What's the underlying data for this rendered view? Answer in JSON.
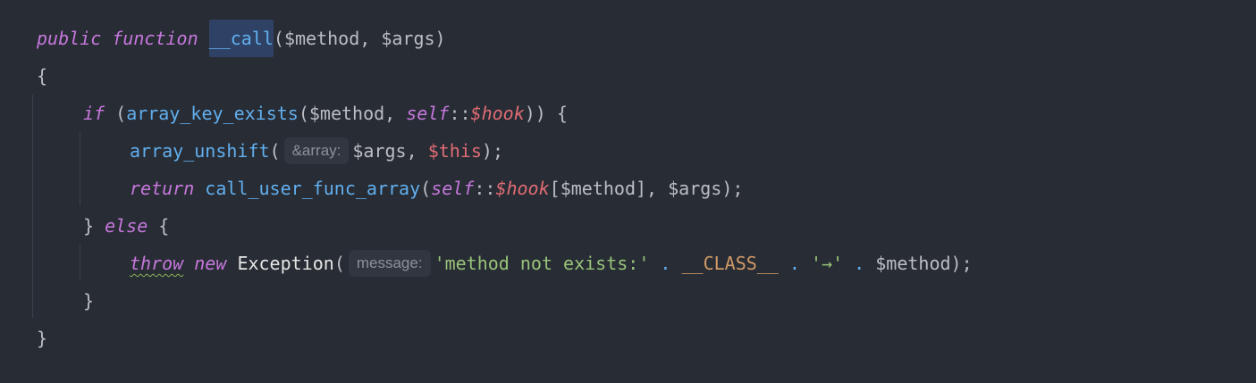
{
  "code": {
    "line1": {
      "public": "public",
      "function": "function",
      "name": "__call",
      "params": "($method, $args)"
    },
    "line2": {
      "brace": "{"
    },
    "line3": {
      "if": "if",
      "open": " (",
      "fn": "array_key_exists",
      "args_open": "($method, ",
      "self": "self",
      "dcolon": "::",
      "hook": "$hook",
      "close": ")) {"
    },
    "line4": {
      "fn": "array_unshift",
      "open": "(",
      "hint": "&array:",
      "args": "$args, ",
      "this": "$this",
      "close": ");"
    },
    "line5": {
      "return": "return",
      "fn": "call_user_func_array",
      "open": "(",
      "self": "self",
      "dcolon": "::",
      "hook": "$hook",
      "rest": "[$method], $args);"
    },
    "line6": {
      "close_brace": "} ",
      "else": "else",
      "open_brace": " {"
    },
    "line7": {
      "throw": "throw",
      "new": "new",
      "class": "Exception",
      "open": "(",
      "hint": "message:",
      "str1": "'method not exists:'",
      "dot1": " . ",
      "const": "__CLASS__",
      "dot2": " . ",
      "str2": "'→'",
      "dot3": " . ",
      "tail": "$method);"
    },
    "line8": {
      "brace": "}"
    },
    "line9": {
      "brace": "}"
    }
  }
}
